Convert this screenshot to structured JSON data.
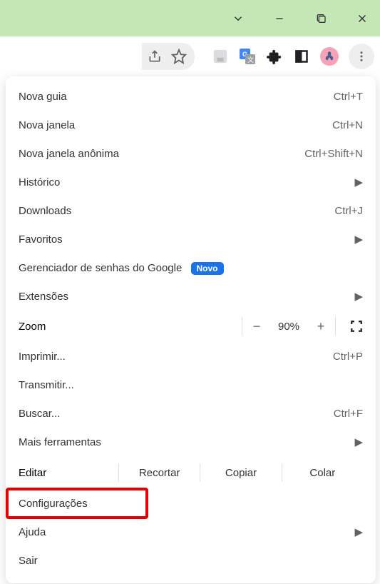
{
  "titlebar": {},
  "toolbar": {},
  "menu": {
    "new_tab": {
      "label": "Nova guia",
      "shortcut": "Ctrl+T"
    },
    "new_window": {
      "label": "Nova janela",
      "shortcut": "Ctrl+N"
    },
    "incognito": {
      "label": "Nova janela anônima",
      "shortcut": "Ctrl+Shift+N"
    },
    "history": {
      "label": "Histórico"
    },
    "downloads": {
      "label": "Downloads",
      "shortcut": "Ctrl+J"
    },
    "bookmarks": {
      "label": "Favoritos"
    },
    "password_manager": {
      "label": "Gerenciador de senhas do Google",
      "badge": "Novo"
    },
    "extensions": {
      "label": "Extensões"
    },
    "zoom": {
      "label": "Zoom",
      "value": "90%"
    },
    "print": {
      "label": "Imprimir...",
      "shortcut": "Ctrl+P"
    },
    "cast": {
      "label": "Transmitir..."
    },
    "find": {
      "label": "Buscar...",
      "shortcut": "Ctrl+F"
    },
    "more_tools": {
      "label": "Mais ferramentas"
    },
    "edit": {
      "label": "Editar",
      "cut": "Recortar",
      "copy": "Copiar",
      "paste": "Colar"
    },
    "settings": {
      "label": "Configurações"
    },
    "help": {
      "label": "Ajuda"
    },
    "exit": {
      "label": "Sair"
    }
  }
}
